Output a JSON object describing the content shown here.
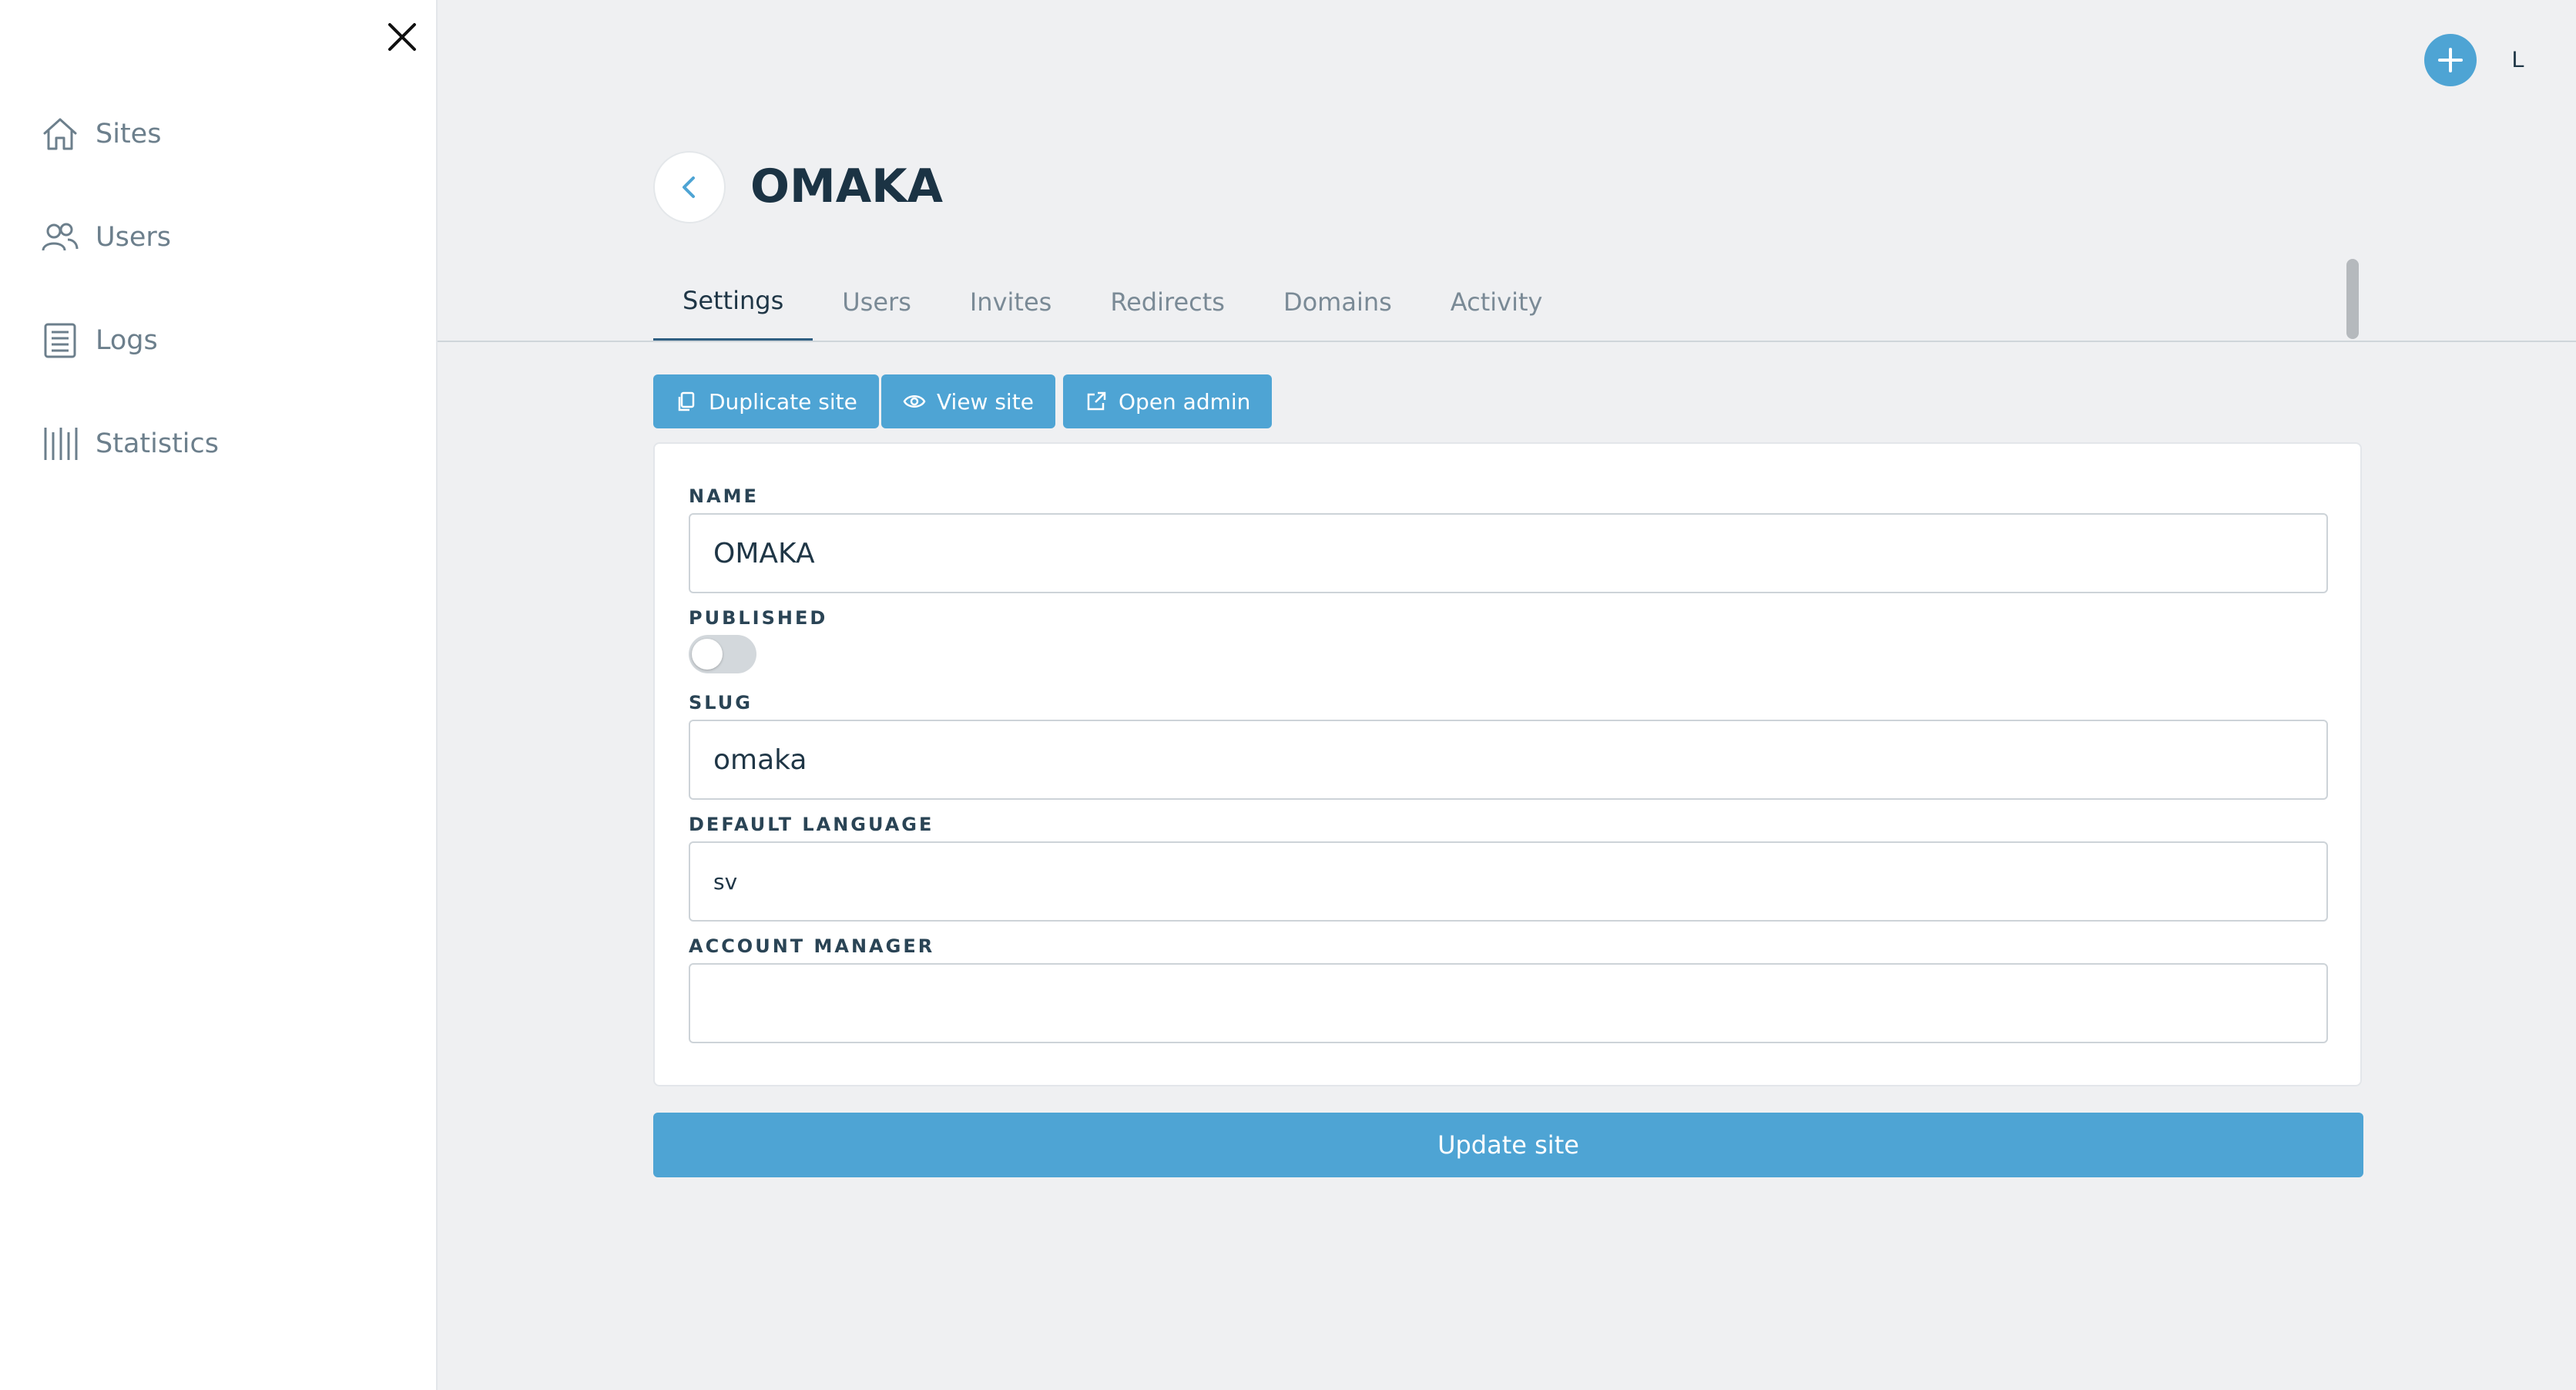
{
  "sidebar": {
    "close_icon": "close-icon",
    "items": [
      {
        "label": "Sites",
        "icon": "home-icon"
      },
      {
        "label": "Users",
        "icon": "users-icon"
      },
      {
        "label": "Logs",
        "icon": "notebook-icon"
      },
      {
        "label": "Statistics",
        "icon": "bars-icon"
      }
    ]
  },
  "topbar": {
    "add_icon": "plus-icon",
    "user_initial": "L"
  },
  "page": {
    "title": "OMAKA",
    "back_icon": "chevron-left-icon"
  },
  "tabs": [
    {
      "label": "Settings",
      "active": true
    },
    {
      "label": "Users",
      "active": false
    },
    {
      "label": "Invites",
      "active": false
    },
    {
      "label": "Redirects",
      "active": false
    },
    {
      "label": "Domains",
      "active": false
    },
    {
      "label": "Activity",
      "active": false
    }
  ],
  "actions": {
    "duplicate": {
      "label": "Duplicate site",
      "icon": "copy-icon"
    },
    "view": {
      "label": "View site",
      "icon": "eye-icon"
    },
    "admin": {
      "label": "Open admin",
      "icon": "external-link-icon"
    }
  },
  "form": {
    "name": {
      "label": "NAME",
      "value": "OMAKA"
    },
    "published": {
      "label": "PUBLISHED",
      "checked": false
    },
    "slug": {
      "label": "SLUG",
      "value": "omaka"
    },
    "default_language": {
      "label": "DEFAULT LANGUAGE",
      "value": "sv"
    },
    "account_manager": {
      "label": "ACCOUNT MANAGER",
      "value": ""
    }
  },
  "submit": {
    "label": "Update site"
  },
  "colors": {
    "accent": "#4ea4d4",
    "background": "#eff0f2",
    "text_dark": "#1f3646",
    "text_muted": "#7a8a96"
  }
}
